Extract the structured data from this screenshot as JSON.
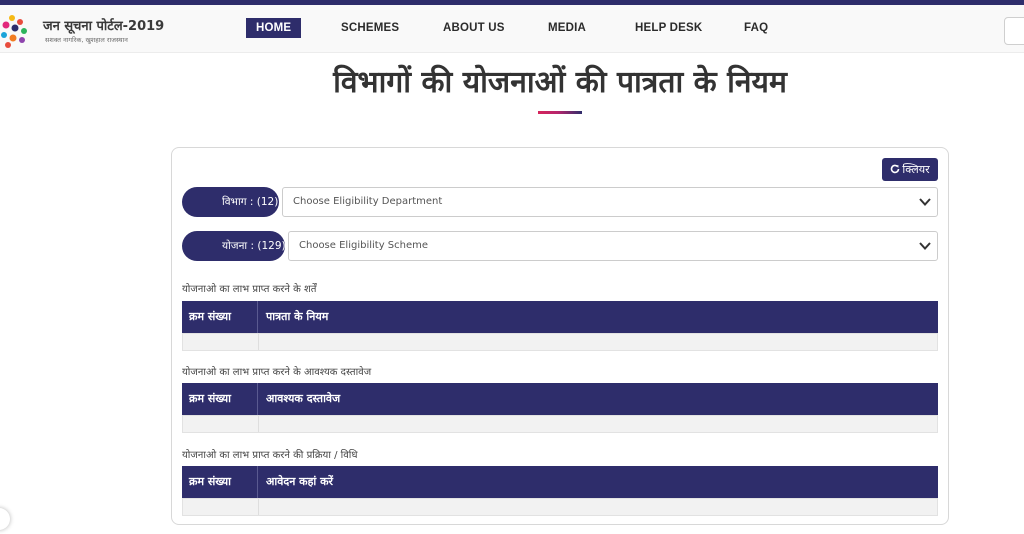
{
  "header": {
    "brand_title": "जन सूचना पोर्टल-2019",
    "brand_subtitle": "सशक्त नागरिक, खुशहाल राजस्थान",
    "nav": [
      {
        "label": "HOME",
        "active": true
      },
      {
        "label": "SCHEMES",
        "active": false
      },
      {
        "label": "ABOUT US",
        "active": false
      },
      {
        "label": "MEDIA",
        "active": false
      },
      {
        "label": "HELP DESK",
        "active": false
      },
      {
        "label": "FAQ",
        "active": false
      }
    ]
  },
  "page_title": "विभागों की योजनाओं की पात्रता के नियम",
  "clear_button_label": "क्लियर",
  "filters": {
    "department": {
      "label": "विभाग : (12)",
      "placeholder": "Choose Eligibility Department"
    },
    "scheme": {
      "label": "योजना : (129)",
      "placeholder": "Choose Eligibility Scheme"
    }
  },
  "sections": [
    {
      "caption": "योजनाओ का लाभ प्राप्त करने के शर्तें",
      "col1": "क्रम संख्या",
      "col2": "पात्रता के नियम"
    },
    {
      "caption": "योजनाओ का लाभ प्राप्त करने के आवश्यक दस्तावेज",
      "col1": "क्रम संख्या",
      "col2": "आवश्यक दस्तावेज"
    },
    {
      "caption": "योजनाओ का लाभ प्राप्त करने की प्रक्रिया / विधि",
      "col1": "क्रम संख्या",
      "col2": "आवेदन कहां करें"
    }
  ],
  "colors": {
    "primary": "#2e2d6b",
    "accent": "#d6245b"
  },
  "icons": {
    "logo": "colorful-dots-logo",
    "refresh": "refresh-icon",
    "dropdown": "chevron-down-icon"
  }
}
